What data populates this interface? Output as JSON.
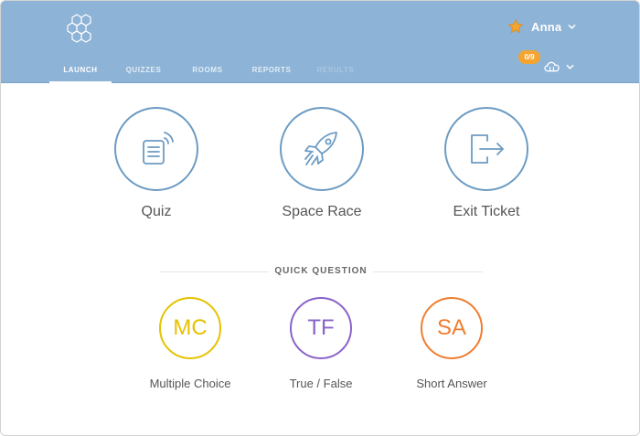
{
  "header": {
    "user_name": "Anna",
    "badge": "0/9",
    "tabs": [
      {
        "label": "LAUNCH",
        "state": "active"
      },
      {
        "label": "QUIZZES",
        "state": "normal"
      },
      {
        "label": "ROOMS",
        "state": "normal"
      },
      {
        "label": "REPORTS",
        "state": "normal"
      },
      {
        "label": "RESULTS",
        "state": "disabled"
      }
    ],
    "icons": {
      "logo": "hexagon-logo-icon",
      "user": "star-icon",
      "cloud": "cloud-icon",
      "menu": "chevron-down-icon"
    }
  },
  "launch": {
    "items": [
      {
        "label": "Quiz",
        "icon": "quiz-document-icon"
      },
      {
        "label": "Space Race",
        "icon": "rocket-icon"
      },
      {
        "label": "Exit Ticket",
        "icon": "exit-door-icon"
      }
    ]
  },
  "quick_question": {
    "title": "QUICK QUESTION",
    "items": [
      {
        "abbr": "MC",
        "label": "Multiple Choice",
        "color": "#e6c200"
      },
      {
        "abbr": "TF",
        "label": "True / False",
        "color": "#8a63c9"
      },
      {
        "abbr": "SA",
        "label": "Short Answer",
        "color": "#ef7d2f"
      }
    ]
  },
  "colors": {
    "header": "#8db3d6",
    "accent": "#6c9bc3",
    "badge": "#f4a431"
  }
}
